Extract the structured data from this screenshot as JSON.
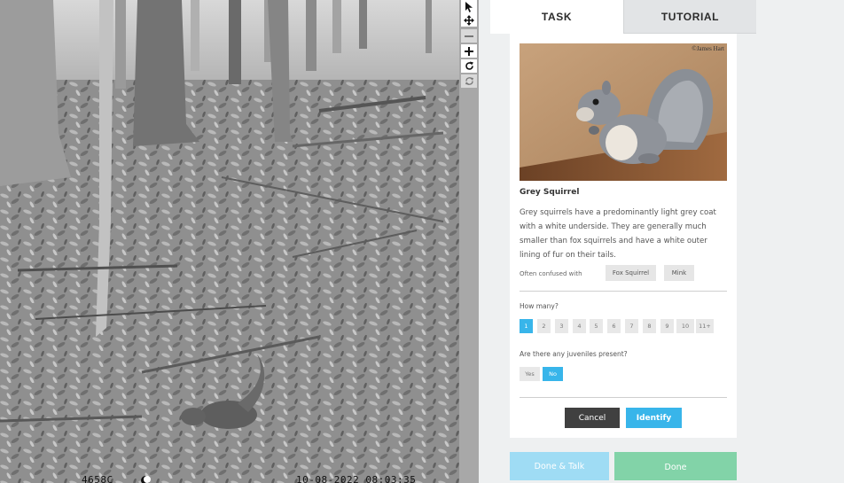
{
  "photo": {
    "stamp_left": "4658C",
    "stamp_right": "10-08-2022 08:03:35"
  },
  "toolbar": {
    "tools": [
      "pointer-icon",
      "move-icon",
      "zoom-out-icon",
      "zoom-in-icon",
      "rotate-icon",
      "reset-icon"
    ]
  },
  "tabs": {
    "task": "TASK",
    "tutorial": "TUTORIAL"
  },
  "species": {
    "credit": "©James Hart",
    "name": "Grey Squirrel",
    "description": "Grey squirrels have a predominantly light grey coat with a white underside. They are generally much smaller than fox squirrels and have a white outer lining of fur on their tails.",
    "confused_label": "Often confused with",
    "confused_with": [
      "Fox Squirrel",
      "Mink"
    ]
  },
  "questions": {
    "how_many_label": "How many?",
    "how_many_options": [
      "1",
      "2",
      "3",
      "4",
      "5",
      "6",
      "7",
      "8",
      "9",
      "10",
      "11+"
    ],
    "how_many_selected": "1",
    "juveniles_label": "Are there any juveniles present?",
    "juveniles_options": [
      "Yes",
      "No"
    ],
    "juveniles_selected": "No"
  },
  "actions": {
    "cancel": "Cancel",
    "identify": "Identify",
    "done_talk": "Done & Talk",
    "done": "Done"
  },
  "colors": {
    "accent": "#38b5ea",
    "done_talk": "#9fdcf4",
    "done": "#82d3a8",
    "cancel": "#404040"
  }
}
